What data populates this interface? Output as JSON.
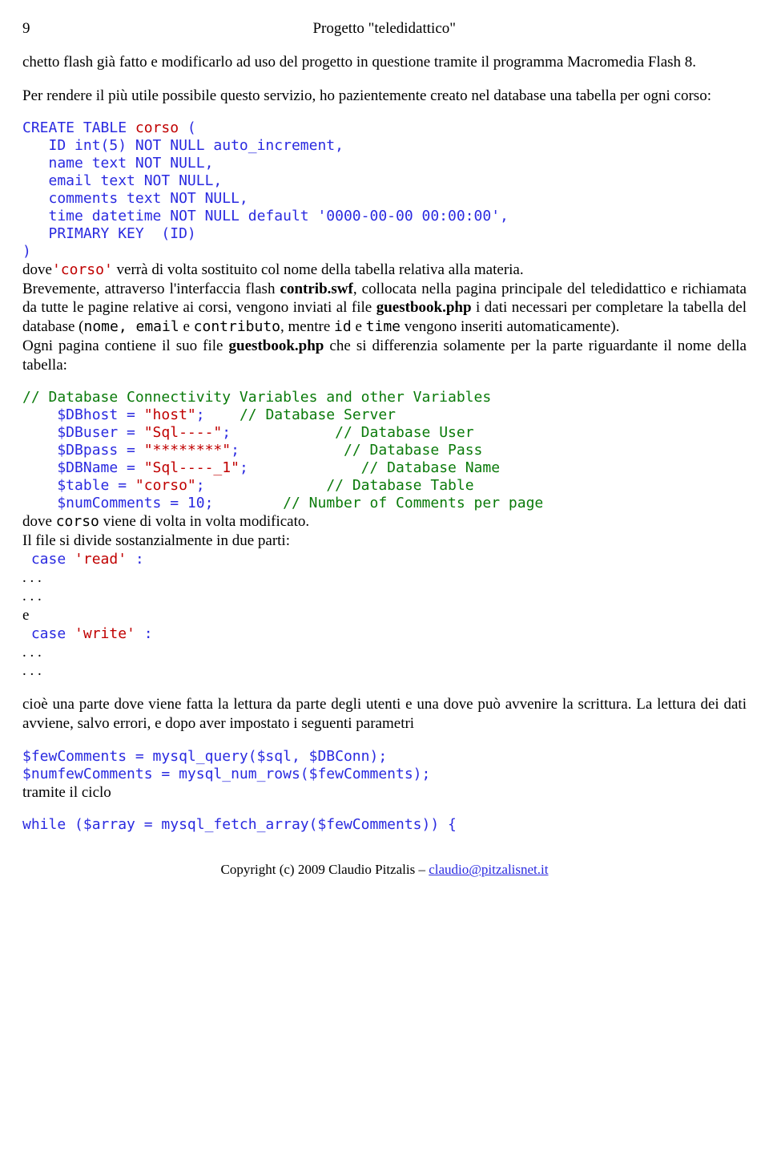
{
  "header": {
    "pageNumber": "9",
    "title": "Progetto \"teledidattico\""
  },
  "para1": "chetto flash già fatto e modificarlo ad uso del progetto in questione tramite il programma Macromedia Flash 8.",
  "para2": "Per rendere il più utile possibile questo servizio, ho pazientemente creato nel database una tabella per ogni corso:",
  "sql": {
    "l1a": "CREATE TABLE ",
    "l1b": "corso",
    "l1c": " (",
    "l2": "   ID int(5) NOT NULL auto_increment,",
    "l3": "   name text NOT NULL,",
    "l4": "   email text NOT NULL,",
    "l5": "   comments text NOT NULL,",
    "l6": "   time datetime NOT NULL default '0000-00-00 00:00:00',",
    "l7": "   PRIMARY KEY  (ID)",
    "l8": ")"
  },
  "para3": {
    "t1": "dove",
    "c1": "'corso'",
    "t2": " verrà di volta sostituito col nome della tabella relativa alla materia."
  },
  "para4": {
    "t1": "Brevemente, attraverso l'interfaccia flash ",
    "b1": "contrib.swf",
    "t2": ", collocata nella pagina principale del teledidattico e richiamata da tutte le pagine relative ai corsi, vengono inviati al file ",
    "b2": "guestbook.php",
    "t3": " i dati necessari per completare la tabella del database (",
    "m1": "nome, email",
    "t4": " e ",
    "m2": "contributo",
    "t5": ", mentre ",
    "m3": "id",
    "t6": " e  ",
    "m4": "time",
    "t7": " vengono inseriti automaticamente)."
  },
  "para5": {
    "t1": "Ogni pagina contiene il suo file ",
    "b1": "guestbook.php",
    "t2": " che si differenzia solamente per la parte riguardante il nome della tabella:"
  },
  "php": {
    "c1": "// Database Connectivity Variables and other Variables",
    "l2a": "    $DBhost = ",
    "l2b": "\"host\"",
    "l2c": ";    ",
    "l2d": "// Database Server",
    "l3a": "    $DBuser = ",
    "l3b": "\"Sql----\"",
    "l3c": ";            ",
    "l3d": "// Database User",
    "l4a": "    $DBpass = ",
    "l4b": "\"********\"",
    "l4c": ";            ",
    "l4d": "// Database Pass",
    "l5a": "    $DBName = ",
    "l5b": "\"Sql----_1\"",
    "l5c": ";             ",
    "l5d": "// Database Name",
    "l6a": "    $table = ",
    "l6b": "\"corso\"",
    "l6c": ";              ",
    "l6d": "// Database Table",
    "l7a": "    $numComments = ",
    "l7b": "10",
    "l7c": ";        ",
    "l7d": "// Number of Comments per page"
  },
  "para6": {
    "t1": "dove ",
    "m1": "corso",
    "t2": " viene di volta in volta modificato."
  },
  "para7": "Il file si divide sostanzialmente in due parti:",
  "case1": {
    "a": " case ",
    "b": "'read'",
    "c": " :"
  },
  "dots": ". . .",
  "eWord": "e",
  "case2": {
    "a": " case ",
    "b": "'write'",
    "c": " :"
  },
  "para8": "cioè una parte dove viene fatta la lettura da parte degli utenti e una dove può avvenire la scrittura. La lettura dei dati avviene, salvo errori, e dopo aver impostato i seguenti parametri",
  "phpq": {
    "l1": "$fewComments = mysql_query($sql, $DBConn);",
    "l2": "$numfewComments = mysql_num_rows($fewComments);"
  },
  "para9": "tramite il ciclo",
  "while": {
    "a": "while",
    "b": " ($array = mysql_fetch_array($fewComments)) {"
  },
  "footer": {
    "text": "Copyright (c) 2009 Claudio Pitzalis – ",
    "email": "claudio@pitzalisnet.it"
  }
}
